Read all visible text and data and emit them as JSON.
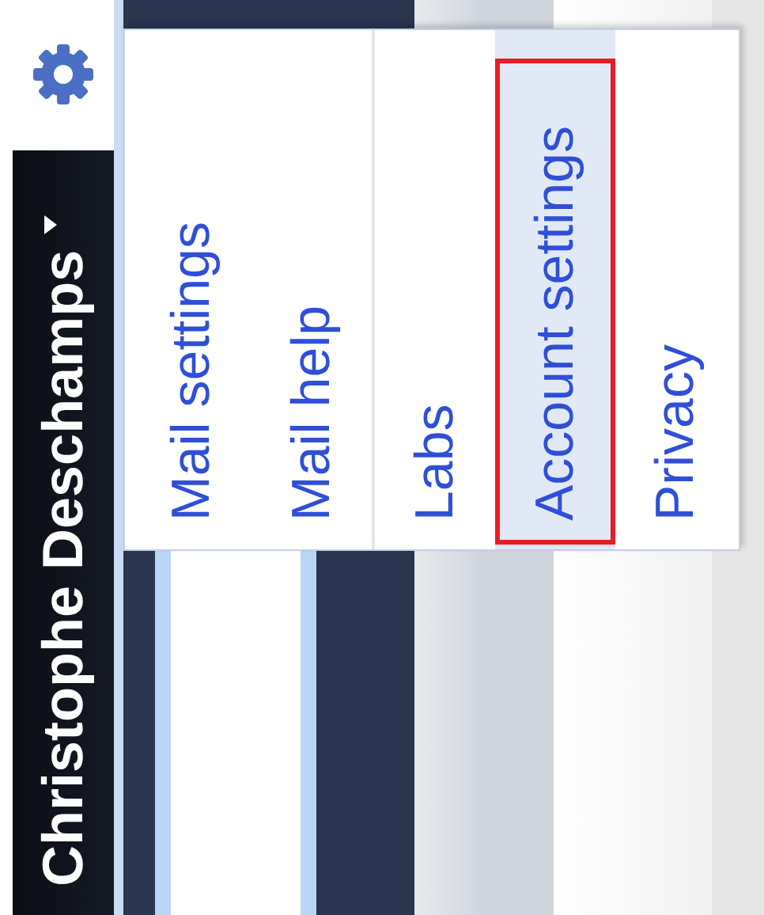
{
  "header": {
    "user_name": "Christophe Deschamps"
  },
  "settings_menu": {
    "sections": [
      {
        "items": [
          {
            "label": "Mail settings",
            "selected": false,
            "annotated": false
          },
          {
            "label": "Mail help",
            "selected": false,
            "annotated": false
          }
        ]
      },
      {
        "items": [
          {
            "label": "Labs",
            "selected": false,
            "annotated": false
          },
          {
            "label": "Account settings",
            "selected": true,
            "annotated": true
          },
          {
            "label": "Privacy",
            "selected": false,
            "annotated": false
          }
        ]
      }
    ]
  }
}
